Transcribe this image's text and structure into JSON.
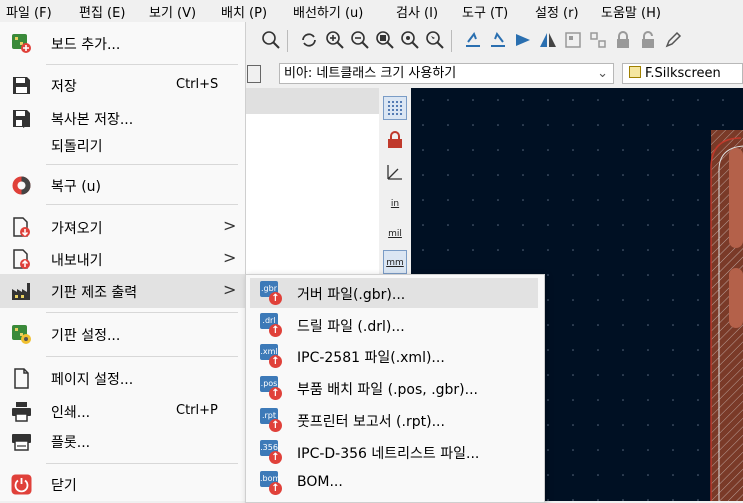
{
  "menubar": [
    {
      "label": "파일 (F)"
    },
    {
      "label": "편집 (E)"
    },
    {
      "label": "보기 (V)"
    },
    {
      "label": "배치 (P)"
    },
    {
      "label": "배선하기 (u)"
    },
    {
      "label": "검사 (I)"
    },
    {
      "label": "도구 (T)"
    },
    {
      "label": "설정 (r)"
    },
    {
      "label": "도움말 (H)"
    }
  ],
  "toolbar2": {
    "netclass_combo": "비아: 네트클래스 크기 사용하기",
    "layer_combo": "F.Silkscreen"
  },
  "side_tools": {
    "inch": "in",
    "mil": "mil",
    "mm": "mm"
  },
  "file_menu": {
    "add_board": "보드 추가...",
    "save": "저장",
    "save_shortcut": "Ctrl+S",
    "save_copy": "복사본 저장...",
    "revert": "되돌리기",
    "recover": "복구 (u)",
    "import": "가져오기",
    "export": "내보내기",
    "fab_outputs": "기판 제조 출력",
    "board_setup": "기판 설정...",
    "page_setup": "페이지 설정...",
    "print": "인쇄...",
    "print_shortcut": "Ctrl+P",
    "plot": "플롯...",
    "close": "닫기",
    "submenu_arrow": ">"
  },
  "fab_submenu": [
    {
      "label": "거버 파일(.gbr)...",
      "badge": ".gbr"
    },
    {
      "label": "드릴 파일 (.drl)...",
      "badge": ".drl"
    },
    {
      "label": "IPC-2581 파일(.xml)...",
      "badge": ".xml"
    },
    {
      "label": "부품 배치 파일 (.pos, .gbr)...",
      "badge": ".pos"
    },
    {
      "label": "풋프린터 보고서 (.rpt)...",
      "badge": ".rpt"
    },
    {
      "label": "IPC-D-356 네트리스트 파일...",
      "badge": ".356"
    },
    {
      "label": "BOM...",
      "badge": ".bom"
    }
  ],
  "colors": {
    "accent_red": "#e0413a",
    "file_blue": "#3d7ab8",
    "canvas_bg": "#001023",
    "board_edge": "#c0392b"
  }
}
